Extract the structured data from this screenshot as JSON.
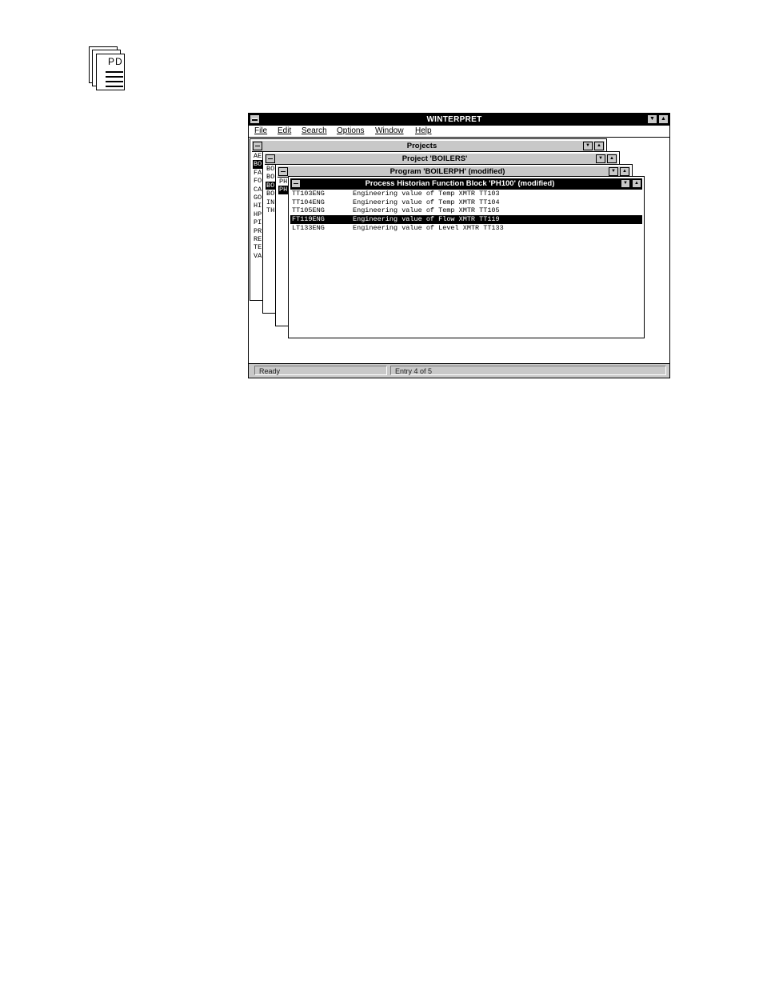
{
  "page_icon": {
    "text": "PD",
    "icon": "document-stack-icon"
  },
  "app": {
    "title": "WINTERPRET",
    "menu": [
      {
        "label": "File",
        "key": "F"
      },
      {
        "label": "Edit",
        "key": "E"
      },
      {
        "label": "Search",
        "key": "S"
      },
      {
        "label": "Options",
        "key": "O"
      },
      {
        "label": "Window",
        "key": "W"
      },
      {
        "label": "Help",
        "key": "H"
      }
    ],
    "status": {
      "state": "Ready",
      "entry": "Entry 4 of 5"
    }
  },
  "windows": {
    "projects": {
      "title": "Projects",
      "items": [
        "AE",
        "BO",
        "FA",
        "FO",
        "CA",
        "GO",
        "HI",
        "HP",
        "PI",
        "PR",
        "RE",
        "TE",
        "VA"
      ],
      "selected_index": 1
    },
    "project": {
      "title": "Project 'BOILERS'",
      "items": [
        "BO",
        "BO",
        "BO",
        "BO",
        "IN",
        "TH"
      ],
      "selected_index": 2
    },
    "program": {
      "title": "Program 'BOILERPH' (modified)",
      "items": [
        "PH",
        "PH"
      ],
      "selected_index": 1
    },
    "function_block": {
      "title": "Process Historian Function Block 'PH100' (modified)",
      "rows": [
        {
          "name": "TT103ENG",
          "description": "Engineering value of Temp XMTR TT103"
        },
        {
          "name": "TT104ENG",
          "description": "Engineering value of Temp XMTR TT104"
        },
        {
          "name": "TT105ENG",
          "description": "Engineering value of Temp XMTR TT105"
        },
        {
          "name": "FT119ENG",
          "description": "Engineering value of Flow XMTR TT119"
        },
        {
          "name": "LT133ENG",
          "description": "Engineering value of Level XMTR TT133"
        }
      ],
      "selected_index": 3
    }
  }
}
